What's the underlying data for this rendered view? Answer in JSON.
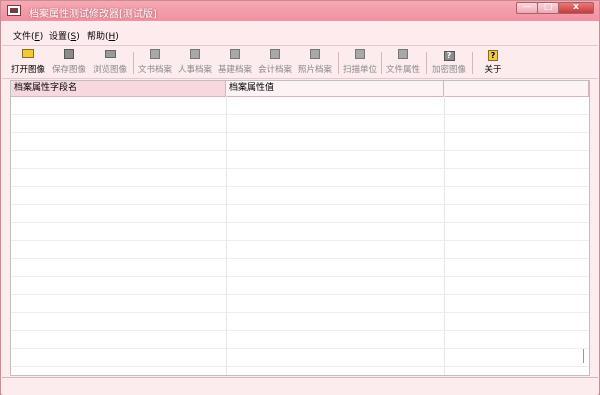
{
  "window": {
    "title": "档案属性测试修改器[测试版]"
  },
  "menu": [
    {
      "label": "文件(",
      "hot": "F",
      "tail": ")"
    },
    {
      "label": "设置(",
      "hot": "S",
      "tail": ")"
    },
    {
      "label": "帮助(",
      "hot": "H",
      "tail": ")"
    }
  ],
  "toolbar": {
    "open_image": "打开图像",
    "save_image": "保存图像",
    "browse_image": "浏览图像",
    "doc_archive": "文书档案",
    "personnel_archive": "人事档案",
    "construction_archive": "基建档案",
    "accounting_archive": "会计档案",
    "photo_archive": "照片档案",
    "scan_unit": "扫描单位",
    "file_property": "文件属性",
    "encrypt_image": "加密图像",
    "about": "关于"
  },
  "grid": {
    "columns": [
      "档案属性字段名",
      "档案属性值",
      ""
    ]
  },
  "statusbar": {
    "text": ""
  }
}
